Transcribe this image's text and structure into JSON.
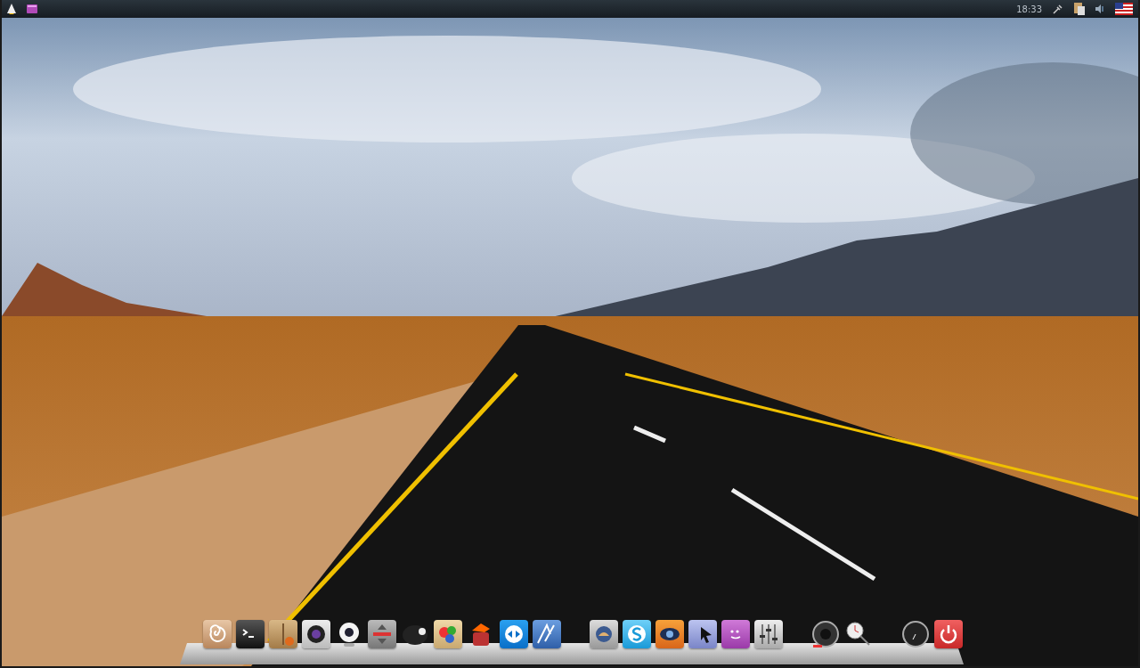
{
  "top_panel": {
    "clock": "18:33"
  }
}
